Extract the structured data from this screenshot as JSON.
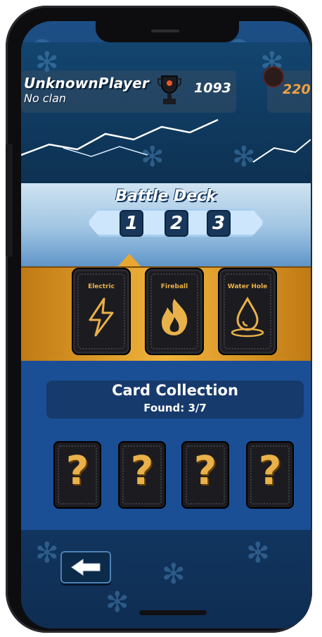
{
  "player": {
    "name": "UnknownPlayer",
    "clan": "No clan",
    "trophies": "1093",
    "gems": "220"
  },
  "battle_deck": {
    "title": "Battle Deck",
    "deck_slots": [
      "1",
      "2",
      "3"
    ],
    "selected_slot": "1",
    "cards": [
      {
        "label": "Electric",
        "icon": "lightning-icon"
      },
      {
        "label": "Fireball",
        "icon": "flame-icon"
      },
      {
        "label": "Water Hole",
        "icon": "water-drop-icon"
      }
    ]
  },
  "collection": {
    "title": "Card Collection",
    "found_text": "Found: 3/7",
    "locked_cards": [
      "?",
      "?",
      "?",
      "?"
    ]
  },
  "colors": {
    "accent_gold": "#e9b14a",
    "deck_bg": "#f2b43c",
    "collection_bg": "#1a4f96"
  },
  "icons": {
    "back": "back-arrow-icon",
    "trophy": "trophy-icon",
    "gem": "gem-icon"
  }
}
